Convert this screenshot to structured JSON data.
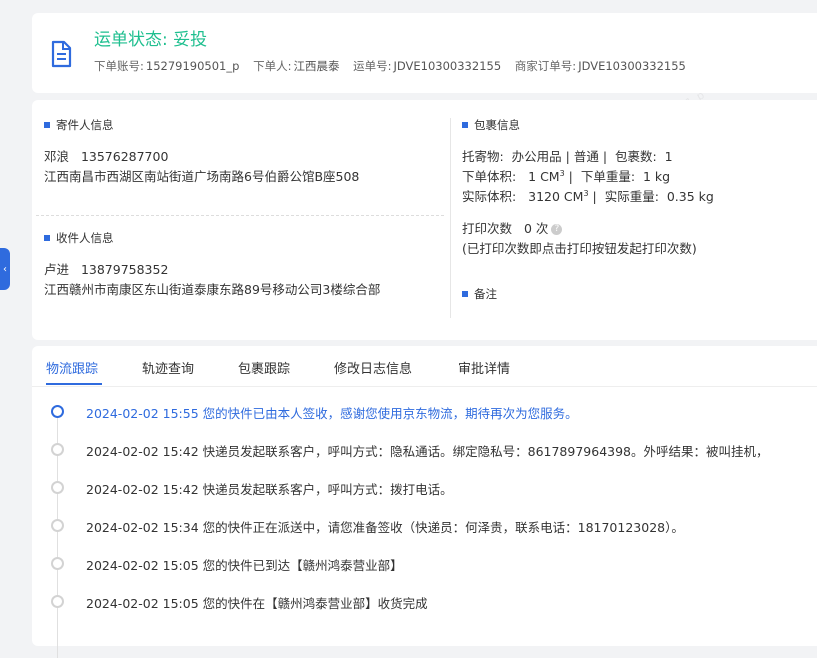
{
  "header": {
    "status_label": "运单状态:",
    "status_value": "妥投",
    "order_account_label": "下单账号:",
    "order_account": "15279190501_p",
    "orderer_label": "下单人:",
    "orderer": "江西晨泰",
    "waybill_label": "运单号:",
    "waybill": "JDVE10300332155",
    "merchant_order_label": "商家订单号:",
    "merchant_order": "JDVE10300332155"
  },
  "sender": {
    "title": "寄件人信息",
    "name": "邓浪",
    "phone": "13576287700",
    "address": "江西南昌市西湖区南站街道广场南路6号伯爵公馆B座508"
  },
  "receiver": {
    "title": "收件人信息",
    "name": "卢进",
    "phone": "13879758352",
    "address": "江西赣州市南康区东山街道泰康东路89号移动公司3楼综合部"
  },
  "package": {
    "title": "包裹信息",
    "goods_label": "托寄物:",
    "goods": "办公用品 | 普通",
    "count_label": "包裹数:",
    "count": "1",
    "order_volume_label": "下单体积:",
    "order_volume": "1 CM",
    "order_weight_label": "下单重量:",
    "order_weight": "1 kg",
    "actual_volume_label": "实际体积:",
    "actual_volume": "3120 CM",
    "actual_weight_label": "实际重量:",
    "actual_weight": "0.35 kg",
    "print_count_label": "打印次数",
    "print_count": "0 次",
    "print_note": "(已打印次数即点击打印按钮发起打印次数)"
  },
  "remarks": {
    "title": "备注"
  },
  "tabs": [
    {
      "label": "物流跟踪"
    },
    {
      "label": "轨迹查询"
    },
    {
      "label": "包裹跟踪"
    },
    {
      "label": "修改日志信息"
    },
    {
      "label": "审批详情"
    }
  ],
  "timeline": [
    {
      "text": "2024-02-02 15:55 您的快件已由本人签收，感谢您使用京东物流，期待再次为您服务。"
    },
    {
      "text": "2024-02-02 15:42 快递员发起联系客户，呼叫方式：隐私通话。绑定隐私号：8617897964398。外呼结果：被叫挂机，"
    },
    {
      "text": "2024-02-02 15:42 快递员发起联系客户，呼叫方式：拨打电话。"
    },
    {
      "text": "2024-02-02 15:34 您的快件正在派送中，请您准备签收（快递员：何泽贵，联系电话：18170123028）。"
    },
    {
      "text": "2024-02-02 15:05 您的快件已到达【赣州鸿泰营业部】"
    },
    {
      "text": "2024-02-02 15:05 您的快件在【赣州鸿泰营业部】收货完成"
    }
  ],
  "watermark": "15279190501_p"
}
